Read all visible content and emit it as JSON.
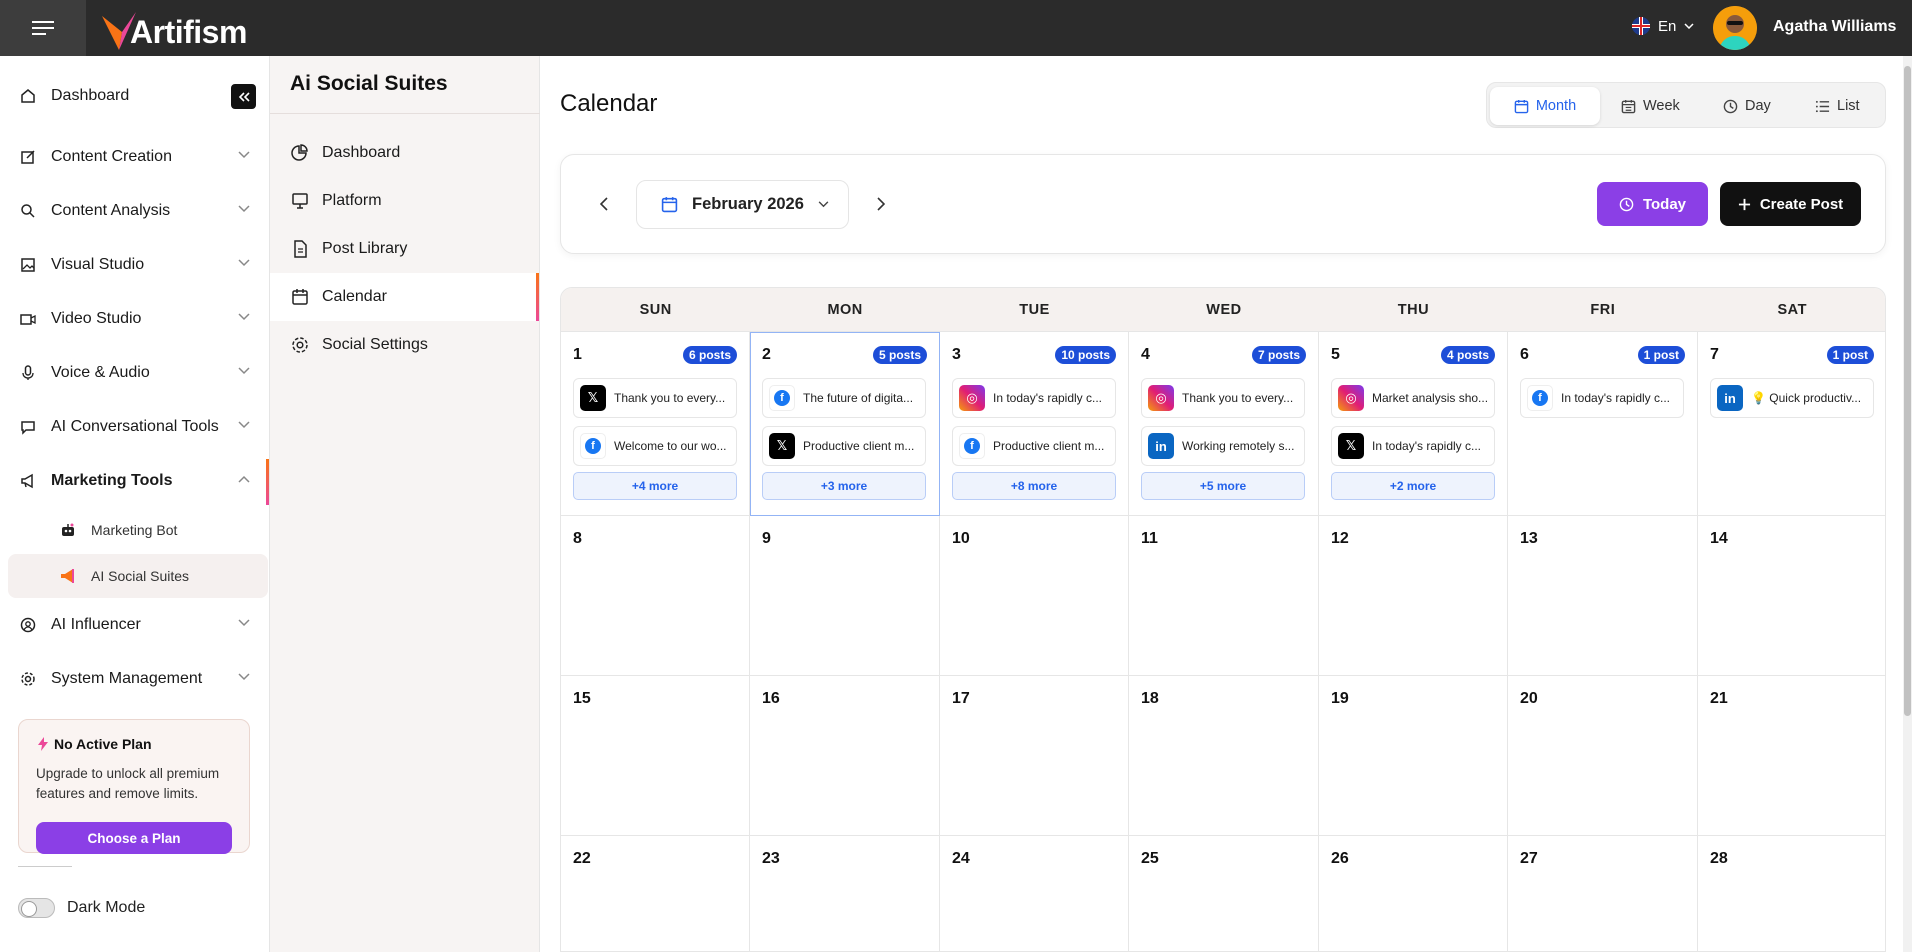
{
  "brand": {
    "name": "Artifism"
  },
  "header": {
    "language": "En",
    "user_name": "Agatha Williams"
  },
  "sidebar": {
    "items": [
      {
        "label": "Dashboard",
        "icon": "home-icon"
      },
      {
        "label": "Content Creation",
        "icon": "edit-icon"
      },
      {
        "label": "Content Analysis",
        "icon": "search-icon"
      },
      {
        "label": "Visual Studio",
        "icon": "image-icon"
      },
      {
        "label": "Video Studio",
        "icon": "video-icon"
      },
      {
        "label": "Voice & Audio",
        "icon": "mic-icon"
      },
      {
        "label": "AI Conversational Tools",
        "icon": "chat-icon"
      },
      {
        "label": "Marketing Tools",
        "icon": "megaphone-icon"
      },
      {
        "label": "AI Influencer",
        "icon": "user-circle-icon"
      },
      {
        "label": "System Management",
        "icon": "gear-icon"
      }
    ],
    "sub_items": [
      {
        "label": "Marketing Bot",
        "icon": "bot-icon"
      },
      {
        "label": "AI Social Suites",
        "icon": "megaphone-color-icon"
      }
    ],
    "plan": {
      "title": "No Active Plan",
      "description": "Upgrade to unlock all premium features and remove limits.",
      "button": "Choose a Plan"
    },
    "dark_mode_label": "Dark Mode"
  },
  "subpanel": {
    "title": "Ai Social Suites",
    "items": [
      {
        "label": "Dashboard",
        "icon": "pie-chart-icon"
      },
      {
        "label": "Platform",
        "icon": "monitor-icon"
      },
      {
        "label": "Post Library",
        "icon": "document-icon"
      },
      {
        "label": "Calendar",
        "icon": "calendar-icon"
      },
      {
        "label": "Social Settings",
        "icon": "gear-icon"
      }
    ]
  },
  "main": {
    "title": "Calendar",
    "views": [
      "Month",
      "Week",
      "Day",
      "List"
    ],
    "active_view": "Month",
    "month_label": "February 2026",
    "today_label": "Today",
    "create_label": "Create Post"
  },
  "calendar": {
    "weekdays": [
      "SUN",
      "MON",
      "TUE",
      "WED",
      "THU",
      "FRI",
      "SAT"
    ],
    "week1": [
      {
        "day": "1",
        "badge": "6 posts",
        "posts": [
          {
            "p": "x",
            "text": "Thank you to every..."
          },
          {
            "p": "fb",
            "text": "Welcome to our wo..."
          }
        ],
        "more": "+4 more"
      },
      {
        "day": "2",
        "badge": "5 posts",
        "posts": [
          {
            "p": "fb",
            "text": "The future of digita..."
          },
          {
            "p": "x",
            "text": "Productive client m..."
          }
        ],
        "more": "+3 more"
      },
      {
        "day": "3",
        "badge": "10 posts",
        "posts": [
          {
            "p": "ig",
            "text": "In today's rapidly c..."
          },
          {
            "p": "fb",
            "text": "Productive client m..."
          }
        ],
        "more": "+8 more"
      },
      {
        "day": "4",
        "badge": "7 posts",
        "posts": [
          {
            "p": "ig",
            "text": "Thank you to every..."
          },
          {
            "p": "li",
            "text": "Working remotely s..."
          }
        ],
        "more": "+5 more"
      },
      {
        "day": "5",
        "badge": "4 posts",
        "posts": [
          {
            "p": "ig",
            "text": "Market analysis sho..."
          },
          {
            "p": "x",
            "text": "In today's rapidly c..."
          }
        ],
        "more": "+2 more"
      },
      {
        "day": "6",
        "badge": "1 post",
        "posts": [
          {
            "p": "fb",
            "text": "In today's rapidly c..."
          }
        ],
        "more": ""
      },
      {
        "day": "7",
        "badge": "1 post",
        "posts": [
          {
            "p": "li",
            "text": "💡 Quick productiv..."
          }
        ],
        "more": ""
      }
    ],
    "weeks_rest": [
      [
        "8",
        "9",
        "10",
        "11",
        "12",
        "13",
        "14"
      ],
      [
        "15",
        "16",
        "17",
        "18",
        "19",
        "20",
        "21"
      ],
      [
        "22",
        "23",
        "24",
        "25",
        "26",
        "27",
        "28"
      ]
    ]
  }
}
